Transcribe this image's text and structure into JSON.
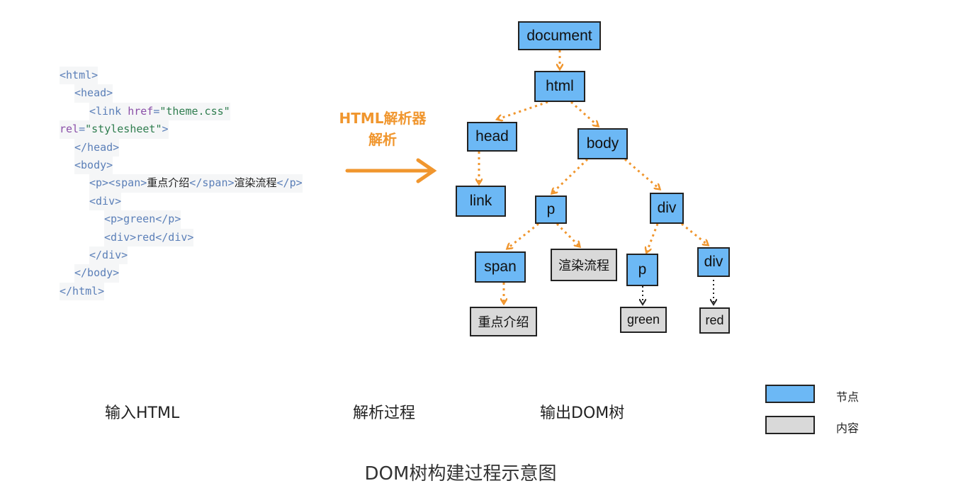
{
  "code_lines": [
    {
      "tag_open": "<html>"
    },
    {
      "tag_open": "<head>"
    },
    {
      "link_open": "<link ",
      "href_attr": "href",
      "href_eq": "=",
      "href_val": "\"theme.css\""
    },
    {
      "rel_attr": "rel",
      "rel_eq": "=",
      "rel_val": "\"stylesheet\"",
      "rel_close": ">"
    },
    {
      "tag_open": "</head>"
    },
    {
      "tag_open": "<body>"
    },
    {
      "p_open": "<p><span>",
      "p_text1": "重点介绍",
      "p_mid": "</span>",
      "p_text2": "渲染流程",
      "p_close": "</p>"
    },
    {
      "tag_open": "<div>"
    },
    {
      "tag_open": "<p>green</p>"
    },
    {
      "tag_open": "<div>red</div>"
    },
    {
      "tag_open": "</div>"
    },
    {
      "tag_open": "</body>"
    },
    {
      "tag_open": "</html>"
    }
  ],
  "parser_label": {
    "line1": "HTML解析器",
    "line2": "解析"
  },
  "tree": {
    "document": "document",
    "html": "html",
    "head": "head",
    "body": "body",
    "link": "link",
    "p": "p",
    "div": "div",
    "span": "span",
    "render_text": "渲染流程",
    "p2": "p",
    "div2": "div",
    "key_text": "重点介绍",
    "green": "green",
    "red": "red"
  },
  "labels": {
    "input": "输入HTML",
    "process": "解析过程",
    "output": "输出DOM树"
  },
  "legend": {
    "node": "节点",
    "content": "内容"
  },
  "caption": "DOM树构建过程示意图",
  "colors": {
    "node": "#6cb8f5",
    "content": "#d9d9d9",
    "arrow": "#f0962e"
  }
}
